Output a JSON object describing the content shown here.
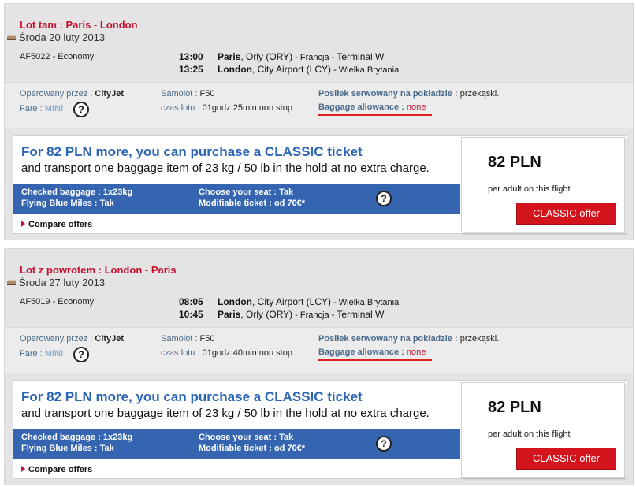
{
  "flights": [
    {
      "title_prefix": "Lot tam : ",
      "from_city": "Paris",
      "sep": " - ",
      "to_city": "London",
      "date": "Środa 20 luty 2013",
      "flight_number": "AF5022 - Economy",
      "dep_time": "13:00",
      "arr_time": "13:25",
      "dep_city": "Paris",
      "dep_airport": ", Orly (ORY)",
      "dep_country": " - Francja - ",
      "dep_terminal": "Terminal W",
      "arr_city": "London",
      "arr_airport": ", City Airport (LCY)",
      "arr_country": " - Wielka Brytania",
      "arr_terminal": "",
      "operated_label": "Operowany przez : ",
      "operated_value": "CityJet",
      "fare_label": "Fare : ",
      "fare_value": "MiNi",
      "plane_label": "Samolot : ",
      "plane_value": "F50",
      "duration_label": "czas lotu : ",
      "duration_value": "01godz.25min non stop",
      "meal_label": "Posiłek serwowany na pokładzie : ",
      "meal_value": "przekąski.",
      "baggage_label": "Baggage allowance : ",
      "baggage_value": "none",
      "help": "?"
    },
    {
      "title_prefix": "Lot z powrotem : ",
      "from_city": "London",
      "sep": " - ",
      "to_city": "Paris",
      "date": "Środa 27 luty 2013",
      "flight_number": "AF5019 - Economy",
      "dep_time": "08:05",
      "arr_time": "10:45",
      "dep_city": "London",
      "dep_airport": ", City Airport (LCY)",
      "dep_country": " - Wielka Brytania",
      "dep_terminal": "",
      "arr_city": "Paris",
      "arr_airport": ", Orly (ORY)",
      "arr_country": " - Francja - ",
      "arr_terminal": "Terminal W",
      "operated_label": "Operowany przez : ",
      "operated_value": "CityJet",
      "fare_label": "Fare : ",
      "fare_value": "MiNi",
      "plane_label": "Samolot : ",
      "plane_value": "F50",
      "duration_label": "czas lotu : ",
      "duration_value": "01godz.40min non stop",
      "meal_label": "Posiłek serwowany na pokładzie : ",
      "meal_value": "przekąski.",
      "baggage_label": "Baggage allowance : ",
      "baggage_value": "none",
      "help": "?"
    }
  ],
  "offer": {
    "headline": "For 82 PLN more, you can purchase a CLASSIC ticket",
    "subline": "and transport one baggage item of 23 kg / 50 lb in the hold at no extra charge.",
    "checked_baggage": "Checked baggage : 1x23kg",
    "flying_blue": "Flying Blue Miles : Tak",
    "choose_seat": "Choose your seat : Tak",
    "modifiable": "Modifiable ticket : od 70€*",
    "help": "?",
    "compare": "Compare offers",
    "price": "82 PLN",
    "price_per": "per adult on this flight",
    "button": "CLASSIC offer"
  },
  "colors": {
    "accent_red": "#c8102e",
    "offer_blue": "#3565b1",
    "headline_blue": "#2b66b5",
    "button_red": "#d4141c"
  },
  "icons": [
    "plane-icon",
    "help-icon",
    "triangle-right-icon"
  ]
}
